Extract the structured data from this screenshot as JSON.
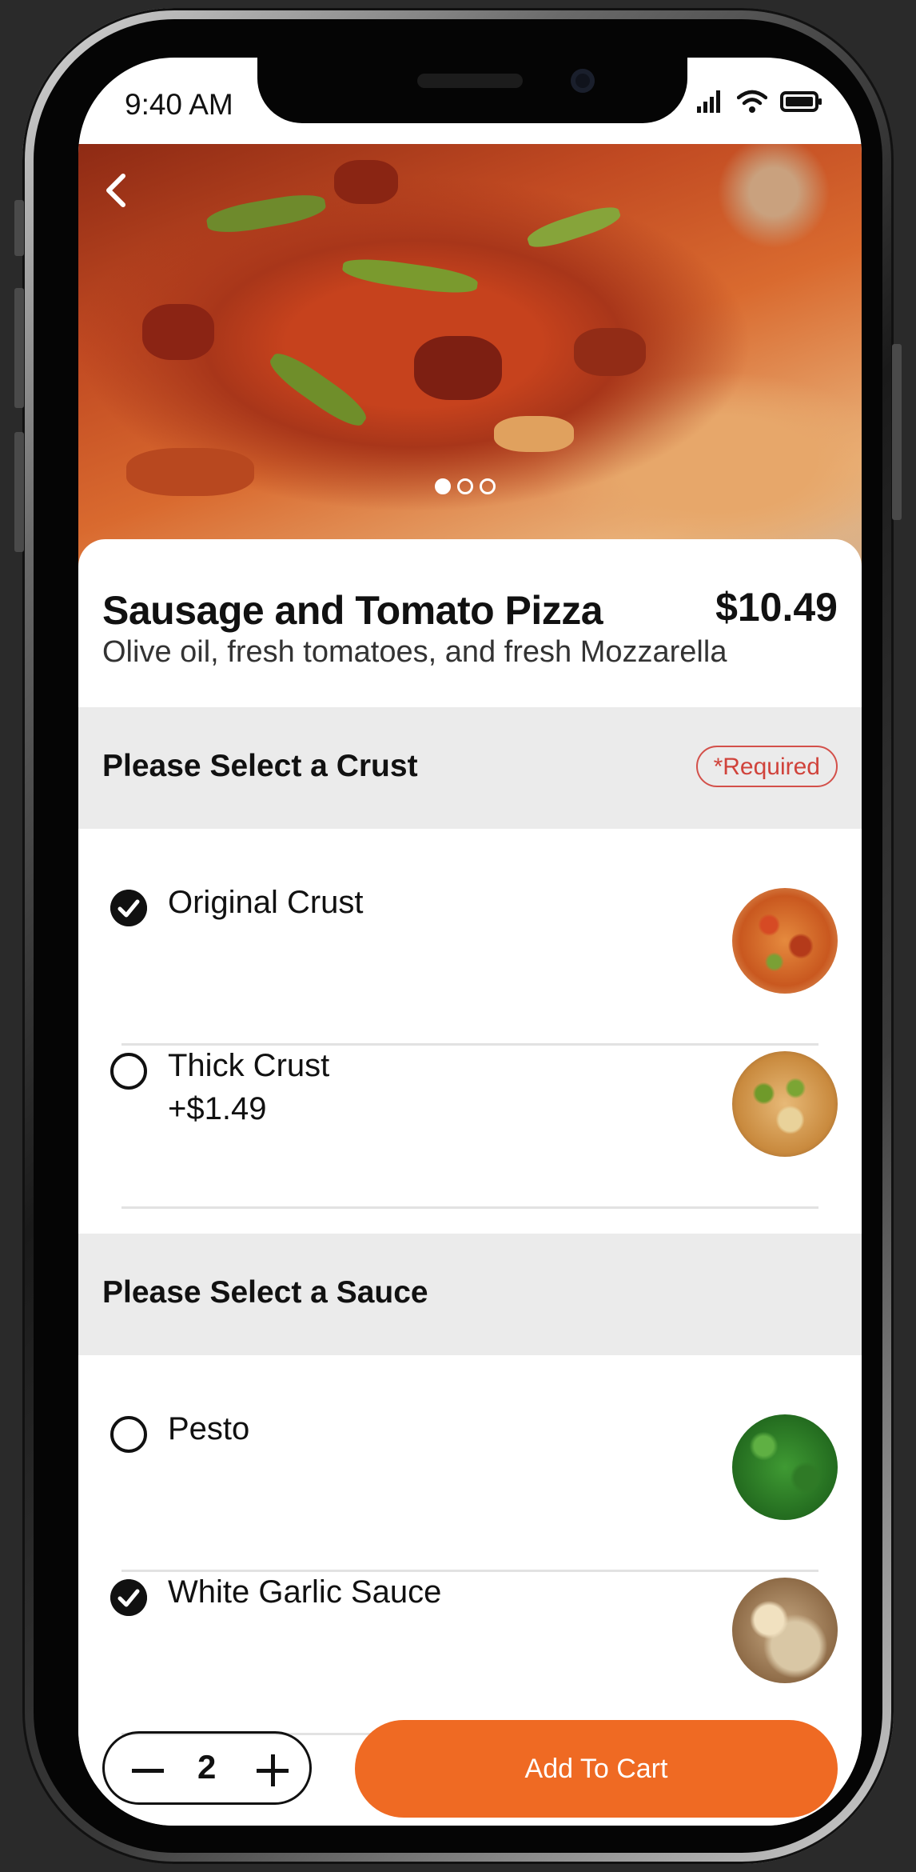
{
  "status_bar": {
    "time": "9:40 AM"
  },
  "colors": {
    "accent": "#ef6a23",
    "required": "#d0433b",
    "section_bg": "#ebebeb"
  },
  "icons": {
    "back": "chevron-left-icon",
    "signal": "signal-icon",
    "wifi": "wifi-icon",
    "battery": "battery-icon",
    "checked": "check-circle-icon",
    "unchecked": "radio-empty-icon"
  },
  "hero": {
    "carousel_index": 1,
    "carousel_count": 3
  },
  "product": {
    "name": "Sausage and Tomato Pizza",
    "price": "$10.49",
    "description": "Olive oil, fresh tomatoes, and fresh Mozzarella"
  },
  "crust": {
    "title": "Please Select a Crust",
    "required_label": "*Required",
    "options": [
      {
        "label": "Original Crust",
        "extra": "",
        "selected": true
      },
      {
        "label": "Thick Crust",
        "extra": "+$1.49",
        "selected": false
      }
    ]
  },
  "sauce": {
    "title": "Please Select a Sauce",
    "options": [
      {
        "label": "Pesto",
        "extra": "",
        "selected": false
      },
      {
        "label": "White Garlic Sauce",
        "extra": "",
        "selected": true
      }
    ]
  },
  "cart": {
    "quantity": "2",
    "add_label": "Add To Cart"
  }
}
